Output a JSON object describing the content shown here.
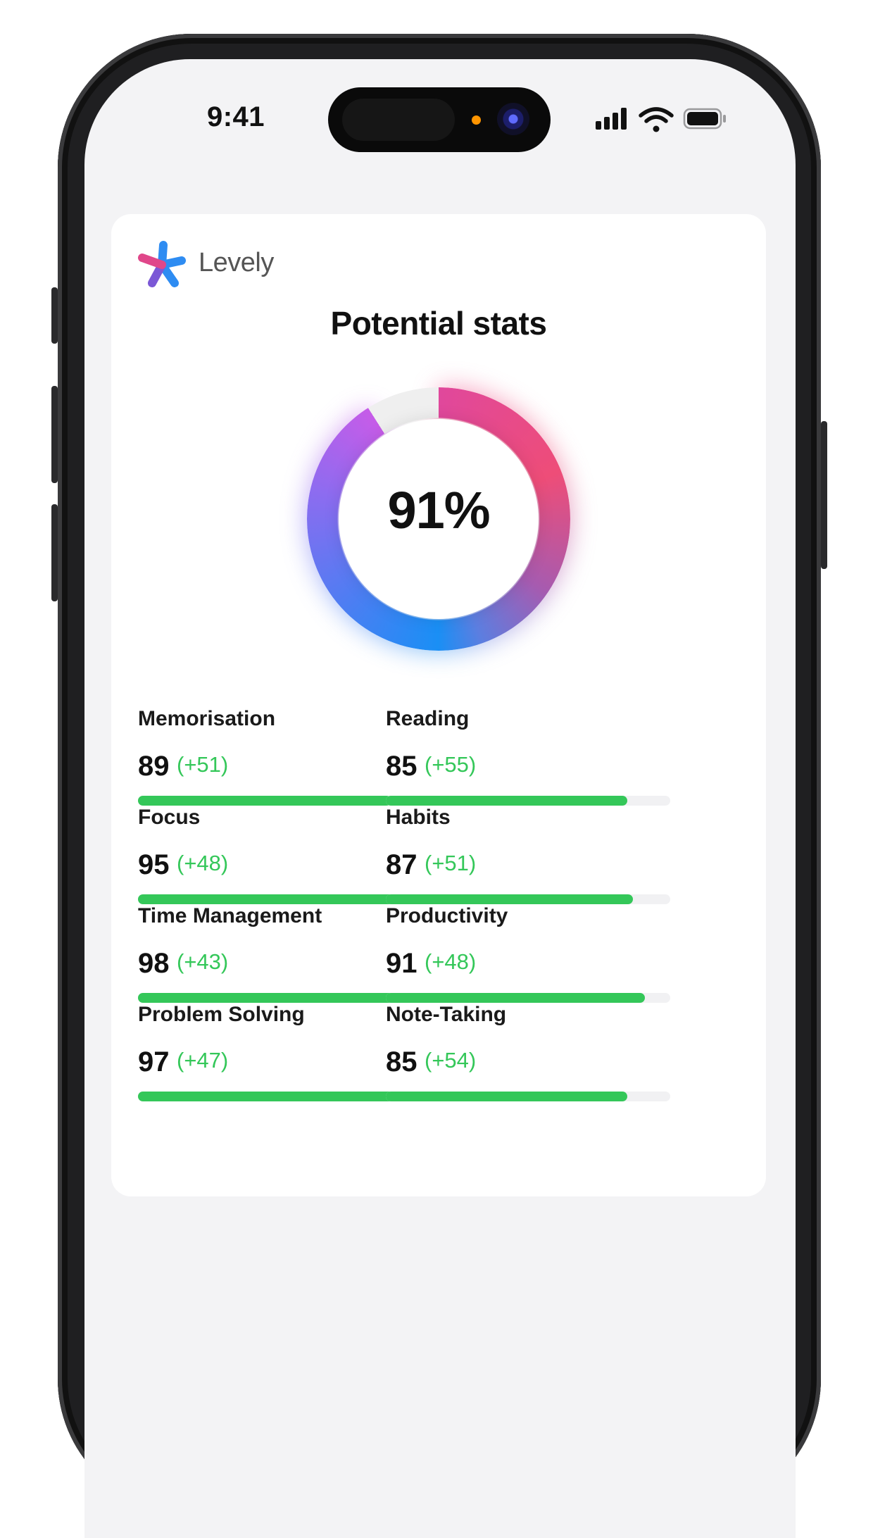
{
  "status_bar": {
    "time": "9:41"
  },
  "app": {
    "brand": "Levely",
    "title": "Potential stats",
    "overall": {
      "value_text": "91%",
      "fraction": 0.91
    }
  },
  "colors": {
    "accent_green": "#34c759",
    "ring_gradient": [
      "#e0489c",
      "#ee4d78",
      "#1a8ff5",
      "#c65ce8"
    ]
  },
  "stats": [
    {
      "label": "Memorisation",
      "value": "89",
      "delta": "(+51)",
      "fraction": 0.89
    },
    {
      "label": "Reading",
      "value": "85",
      "delta": "(+55)",
      "fraction": 0.85
    },
    {
      "label": "Focus",
      "value": "95",
      "delta": "(+48)",
      "fraction": 0.95
    },
    {
      "label": "Habits",
      "value": "87",
      "delta": "(+51)",
      "fraction": 0.87
    },
    {
      "label": "Time Management",
      "value": "98",
      "delta": "(+43)",
      "fraction": 0.98
    },
    {
      "label": "Productivity",
      "value": "91",
      "delta": "(+48)",
      "fraction": 0.91
    },
    {
      "label": "Problem Solving",
      "value": "97",
      "delta": "(+47)",
      "fraction": 0.97
    },
    {
      "label": "Note-Taking",
      "value": "85",
      "delta": "(+54)",
      "fraction": 0.85
    }
  ]
}
